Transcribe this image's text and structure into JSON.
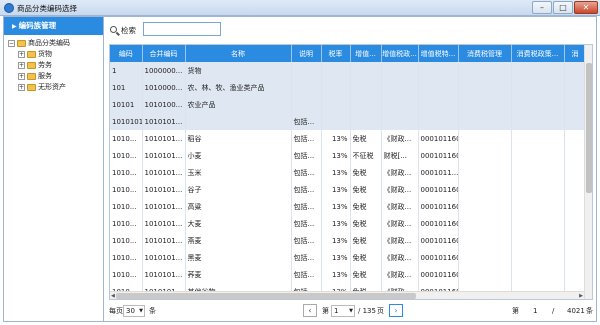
{
  "window": {
    "title": "商品分类编码选择",
    "min": "–",
    "max": "□",
    "close": "✕"
  },
  "left": {
    "header": "编码族管理",
    "tree": [
      {
        "label": "商品分类编码",
        "level": 0,
        "expander": "−"
      },
      {
        "label": "货物",
        "level": 1,
        "expander": "+"
      },
      {
        "label": "劳务",
        "level": 1,
        "expander": "+"
      },
      {
        "label": "服务",
        "level": 1,
        "expander": "+"
      },
      {
        "label": "无形资产",
        "level": 1,
        "expander": "+"
      }
    ]
  },
  "search": {
    "label": "检索",
    "value": "",
    "placeholder": ""
  },
  "table": {
    "columns": [
      "编码",
      "合并编码",
      "名称",
      "说明",
      "税率",
      "增值...",
      "增值税政...",
      "增值税特...",
      "消费税管理",
      "消费税政策...",
      "消"
    ],
    "rows": [
      {
        "sel": true,
        "cells": [
          "1",
          "1000000...",
          "货物",
          "",
          "",
          "",
          "",
          "",
          "",
          "",
          ""
        ]
      },
      {
        "sel": true,
        "cells": [
          "101",
          "1010000...",
          "农、林、牧、渔业类产品",
          "",
          "",
          "",
          "",
          "",
          "",
          "",
          ""
        ]
      },
      {
        "sel": true,
        "cells": [
          "10101",
          "1010100...",
          "农业产品",
          "",
          "",
          "",
          "",
          "",
          "",
          "",
          ""
        ]
      },
      {
        "sel": true,
        "cells": [
          "1010101",
          "1010101...",
          "",
          "包括...",
          "",
          "",
          "",
          "",
          "",
          "",
          ""
        ]
      },
      {
        "sel": false,
        "cells": [
          "1010...",
          "1010101...",
          "稻谷",
          "包括...",
          "13%",
          "免税",
          "《财政...",
          "0001011606",
          "",
          "",
          ""
        ]
      },
      {
        "sel": false,
        "cells": [
          "1010...",
          "1010101...",
          "小麦",
          "包括...",
          "13%",
          "不征税",
          "财税[...",
          "0001011606",
          "",
          "",
          ""
        ]
      },
      {
        "sel": false,
        "cells": [
          "1010...",
          "1010101...",
          "玉米",
          "包括...",
          "13%",
          "免税",
          "《财政...",
          "0001011...",
          "",
          "",
          ""
        ]
      },
      {
        "sel": false,
        "cells": [
          "1010...",
          "1010101...",
          "谷子",
          "包括...",
          "13%",
          "免税",
          "《财政...",
          "0001011606",
          "",
          "",
          ""
        ]
      },
      {
        "sel": false,
        "cells": [
          "1010...",
          "1010101...",
          "高粱",
          "包括...",
          "13%",
          "免税",
          "《财政...",
          "0001011606",
          "",
          "",
          ""
        ]
      },
      {
        "sel": false,
        "cells": [
          "1010...",
          "1010101...",
          "大麦",
          "包括...",
          "13%",
          "免税",
          "《财政...",
          "0001011606",
          "",
          "",
          ""
        ]
      },
      {
        "sel": false,
        "cells": [
          "1010...",
          "1010101...",
          "燕麦",
          "包括...",
          "13%",
          "免税",
          "《财政...",
          "0001011606",
          "",
          "",
          ""
        ]
      },
      {
        "sel": false,
        "cells": [
          "1010...",
          "1010101...",
          "黑麦",
          "包括...",
          "13%",
          "免税",
          "《财政...",
          "0001011606",
          "",
          "",
          ""
        ]
      },
      {
        "sel": false,
        "cells": [
          "1010...",
          "1010101...",
          "荞麦",
          "包括...",
          "13%",
          "免税",
          "《财政...",
          "0001011606",
          "",
          "",
          ""
        ]
      },
      {
        "sel": false,
        "cells": [
          "1010...",
          "1010101...",
          "其他谷物",
          "包括...",
          "13%",
          "免税",
          "《财政...",
          "0001011606",
          "",
          "",
          ""
        ]
      }
    ]
  },
  "pager": {
    "per_page_label": "每页",
    "per_page": "30",
    "per_page_unit": "条",
    "prev": "‹",
    "page_prefix": "第",
    "page": "1",
    "total_pages": "/ 135",
    "page_suffix": "页",
    "next": "›",
    "summary_prefix": "第",
    "summary_start": "1",
    "summary_sep": "/",
    "total": "4021",
    "summary_suffix": "条"
  }
}
